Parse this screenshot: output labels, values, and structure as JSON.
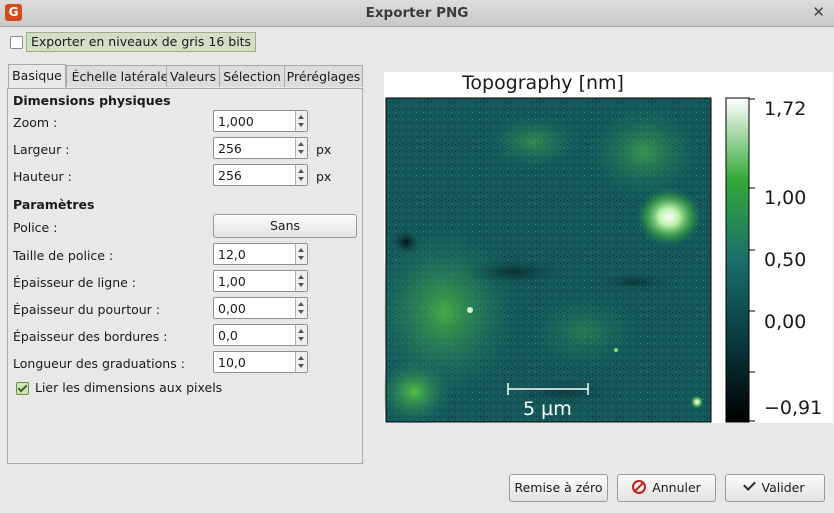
{
  "window": {
    "title": "Exporter PNG",
    "app_icon": "gwyddion-logo-icon",
    "close_icon": "close-icon"
  },
  "gray16": {
    "label": "Exporter en niveaux de gris 16 bits",
    "checked": false
  },
  "tabs": [
    {
      "label": "Basique",
      "active": true
    },
    {
      "label": "Échelle latérale",
      "active": false
    },
    {
      "label": "Valeurs",
      "active": false
    },
    {
      "label": "Sélection",
      "active": false
    },
    {
      "label": "Préréglages",
      "active": false
    }
  ],
  "physical": {
    "title": "Dimensions physiques",
    "zoom": {
      "label": "Zoom :",
      "value": "1,000"
    },
    "width": {
      "label": "Largeur :",
      "value": "256",
      "unit": "px"
    },
    "height": {
      "label": "Hauteur :",
      "value": "256",
      "unit": "px"
    }
  },
  "params": {
    "title": "Paramètres",
    "font": {
      "label": "Police :",
      "value": "Sans"
    },
    "font_size": {
      "label": "Taille de police :",
      "value": "12,0"
    },
    "line_width": {
      "label": "Épaisseur de ligne :",
      "value": "1,00"
    },
    "outline_width": {
      "label": "Épaisseur du pourtour :",
      "value": "0,00"
    },
    "border_width": {
      "label": "Épaisseur des bordures :",
      "value": "0,0"
    },
    "tick_length": {
      "label": "Longueur des graduations :",
      "value": "10,0"
    },
    "link_pixels": {
      "label": "Lier les dimensions aux pixels",
      "checked": true
    }
  },
  "preview": {
    "title": "Topography [nm]",
    "scalebar_label": "5 µm",
    "colorbar_labels": [
      "1,72",
      "1,00",
      "0,50",
      "0,00",
      "−0,91"
    ],
    "colorbar_range": [
      -0.91,
      1.72
    ],
    "colormap": [
      "#000000",
      "#0a3a3e",
      "#1a6e6a",
      "#36a83a",
      "#ffffff"
    ]
  },
  "buttons": {
    "reset": "Remise à zéro",
    "cancel": "Annuler",
    "ok": "Valider"
  }
}
